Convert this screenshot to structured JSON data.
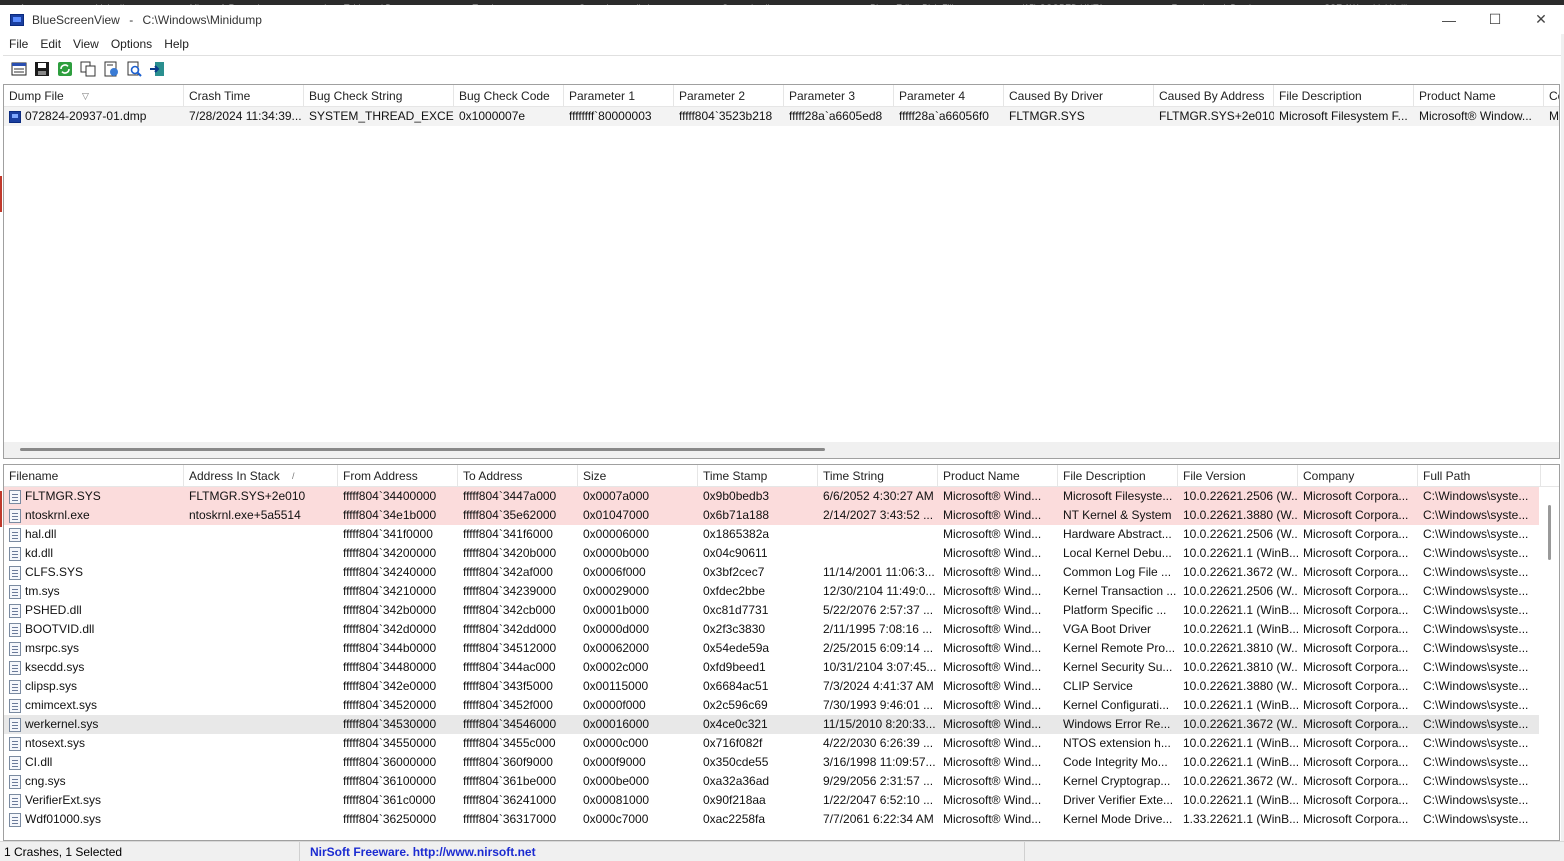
{
  "browser_tabs": [
    "...atsApp",
    "LinkedIn",
    "Microsoft Rewards",
    "Loot Table and Drop...",
    "Tacelt per...",
    "Grenades predictio...",
    "Sursa de alimentare...",
    "Photo Editor Pixlr Fili...",
    "(15) SCOPED UNTA...",
    "Forum thread: Destin...",
    "CSE AW: quidel Holli...",
    "Question - FC BGO..."
  ],
  "window": {
    "app_name": "BlueScreenView",
    "separator": "-",
    "path": "C:\\Windows\\Minidump",
    "minimize": "—",
    "maximize": "☐",
    "close": "✕"
  },
  "menu": [
    "File",
    "Edit",
    "View",
    "Options",
    "Help"
  ],
  "toolbar": [
    {
      "icon": "properties-icon",
      "tooltip": ""
    },
    {
      "icon": "save-icon",
      "tooltip": ""
    },
    {
      "icon": "refresh-icon",
      "tooltip": ""
    },
    {
      "icon": "copy-icon",
      "tooltip": ""
    },
    {
      "icon": "html-report-icon",
      "tooltip": ""
    },
    {
      "icon": "find-icon",
      "tooltip": ""
    },
    {
      "icon": "exit-icon",
      "tooltip": ""
    }
  ],
  "crashes": {
    "columns": [
      "Dump File",
      "Crash Time",
      "Bug Check String",
      "Bug Check Code",
      "Parameter 1",
      "Parameter 2",
      "Parameter 3",
      "Parameter 4",
      "Caused By Driver",
      "Caused By Address",
      "File Description",
      "Product Name",
      "Co"
    ],
    "sort_indicator": "▽",
    "rows": [
      [
        "072824-20937-01.dmp",
        "7/28/2024 11:34:39...",
        "SYSTEM_THREAD_EXCE...",
        "0x1000007e",
        "ffffffff`80000003",
        "fffff804`3523b218",
        "fffff28a`a6605ed8",
        "fffff28a`a66056f0",
        "FLTMGR.SYS",
        "FLTMGR.SYS+2e010",
        "Microsoft Filesystem F...",
        "Microsoft® Window...",
        "M"
      ]
    ]
  },
  "modules": {
    "columns": [
      "Filename",
      "Address In Stack",
      "From Address",
      "To Address",
      "Size",
      "Time Stamp",
      "Time String",
      "Product Name",
      "File Description",
      "File Version",
      "Company",
      "Full Path"
    ],
    "sort_indicator": "/",
    "rows": [
      {
        "style": "red",
        "cells": [
          "FLTMGR.SYS",
          "FLTMGR.SYS+2e010",
          "fffff804`34400000",
          "fffff804`3447a000",
          "0x0007a000",
          "0x9b0bedb3",
          "6/6/2052 4:30:27 AM",
          "Microsoft® Wind...",
          "Microsoft Filesyste...",
          "10.0.22621.2506 (W...",
          "Microsoft Corpora...",
          "C:\\Windows\\syste..."
        ]
      },
      {
        "style": "red",
        "cells": [
          "ntoskrnl.exe",
          "ntoskrnl.exe+5a5514",
          "fffff804`34e1b000",
          "fffff804`35e62000",
          "0x01047000",
          "0x6b71a188",
          "2/14/2027 3:43:52 ...",
          "Microsoft® Wind...",
          "NT Kernel & System",
          "10.0.22621.3880 (W...",
          "Microsoft Corpora...",
          "C:\\Windows\\syste..."
        ]
      },
      {
        "style": "",
        "cells": [
          "hal.dll",
          "",
          "fffff804`341f0000",
          "fffff804`341f6000",
          "0x00006000",
          "0x1865382a",
          "",
          "Microsoft® Wind...",
          "Hardware Abstract...",
          "10.0.22621.2506 (W...",
          "Microsoft Corpora...",
          "C:\\Windows\\syste..."
        ]
      },
      {
        "style": "",
        "cells": [
          "kd.dll",
          "",
          "fffff804`34200000",
          "fffff804`3420b000",
          "0x0000b000",
          "0x04c90611",
          "",
          "Microsoft® Wind...",
          "Local Kernel Debu...",
          "10.0.22621.1 (WinB...",
          "Microsoft Corpora...",
          "C:\\Windows\\syste..."
        ]
      },
      {
        "style": "",
        "cells": [
          "CLFS.SYS",
          "",
          "fffff804`34240000",
          "fffff804`342af000",
          "0x0006f000",
          "0x3bf2cec7",
          "11/14/2001 11:06:3...",
          "Microsoft® Wind...",
          "Common Log File ...",
          "10.0.22621.3672 (W...",
          "Microsoft Corpora...",
          "C:\\Windows\\syste..."
        ]
      },
      {
        "style": "",
        "cells": [
          "tm.sys",
          "",
          "fffff804`34210000",
          "fffff804`34239000",
          "0x00029000",
          "0xfdec2bbe",
          "12/30/2104 11:49:0...",
          "Microsoft® Wind...",
          "Kernel Transaction ...",
          "10.0.22621.2506 (W...",
          "Microsoft Corpora...",
          "C:\\Windows\\syste..."
        ]
      },
      {
        "style": "",
        "cells": [
          "PSHED.dll",
          "",
          "fffff804`342b0000",
          "fffff804`342cb000",
          "0x0001b000",
          "0xc81d7731",
          "5/22/2076 2:57:37 ...",
          "Microsoft® Wind...",
          "Platform Specific ...",
          "10.0.22621.1 (WinB...",
          "Microsoft Corpora...",
          "C:\\Windows\\syste..."
        ]
      },
      {
        "style": "",
        "cells": [
          "BOOTVID.dll",
          "",
          "fffff804`342d0000",
          "fffff804`342dd000",
          "0x0000d000",
          "0x2f3c3830",
          "2/11/1995 7:08:16 ...",
          "Microsoft® Wind...",
          "VGA Boot Driver",
          "10.0.22621.1 (WinB...",
          "Microsoft Corpora...",
          "C:\\Windows\\syste..."
        ]
      },
      {
        "style": "",
        "cells": [
          "msrpc.sys",
          "",
          "fffff804`344b0000",
          "fffff804`34512000",
          "0x00062000",
          "0x54ede59a",
          "2/25/2015 6:09:14 ...",
          "Microsoft® Wind...",
          "Kernel Remote Pro...",
          "10.0.22621.3810 (W...",
          "Microsoft Corpora...",
          "C:\\Windows\\syste..."
        ]
      },
      {
        "style": "",
        "cells": [
          "ksecdd.sys",
          "",
          "fffff804`34480000",
          "fffff804`344ac000",
          "0x0002c000",
          "0xfd9beed1",
          "10/31/2104 3:07:45...",
          "Microsoft® Wind...",
          "Kernel Security Su...",
          "10.0.22621.3810 (W...",
          "Microsoft Corpora...",
          "C:\\Windows\\syste..."
        ]
      },
      {
        "style": "",
        "cells": [
          "clipsp.sys",
          "",
          "fffff804`342e0000",
          "fffff804`343f5000",
          "0x00115000",
          "0x6684ac51",
          "7/3/2024 4:41:37 AM",
          "Microsoft® Wind...",
          "CLIP Service",
          "10.0.22621.3880 (W...",
          "Microsoft Corpora...",
          "C:\\Windows\\syste..."
        ]
      },
      {
        "style": "",
        "cells": [
          "cmimcext.sys",
          "",
          "fffff804`34520000",
          "fffff804`3452f000",
          "0x0000f000",
          "0x2c596c69",
          "7/30/1993 9:46:01 ...",
          "Microsoft® Wind...",
          "Kernel Configurati...",
          "10.0.22621.1 (WinB...",
          "Microsoft Corpora...",
          "C:\\Windows\\syste..."
        ]
      },
      {
        "style": "grey",
        "cells": [
          "werkernel.sys",
          "",
          "fffff804`34530000",
          "fffff804`34546000",
          "0x00016000",
          "0x4ce0c321",
          "11/15/2010 8:20:33...",
          "Microsoft® Wind...",
          "Windows Error Re...",
          "10.0.22621.3672 (W...",
          "Microsoft Corpora...",
          "C:\\Windows\\syste..."
        ]
      },
      {
        "style": "",
        "cells": [
          "ntosext.sys",
          "",
          "fffff804`34550000",
          "fffff804`3455c000",
          "0x0000c000",
          "0x716f082f",
          "4/22/2030 6:26:39 ...",
          "Microsoft® Wind...",
          "NTOS extension h...",
          "10.0.22621.1 (WinB...",
          "Microsoft Corpora...",
          "C:\\Windows\\syste..."
        ]
      },
      {
        "style": "",
        "cells": [
          "CI.dll",
          "",
          "fffff804`36000000",
          "fffff804`360f9000",
          "0x000f9000",
          "0x350cde55",
          "3/16/1998 11:09:57...",
          "Microsoft® Wind...",
          "Code Integrity Mo...",
          "10.0.22621.1 (WinB...",
          "Microsoft Corpora...",
          "C:\\Windows\\syste..."
        ]
      },
      {
        "style": "",
        "cells": [
          "cng.sys",
          "",
          "fffff804`36100000",
          "fffff804`361be000",
          "0x000be000",
          "0xa32a36ad",
          "9/29/2056 2:31:57 ...",
          "Microsoft® Wind...",
          "Kernel Cryptograp...",
          "10.0.22621.3672 (W...",
          "Microsoft Corpora...",
          "C:\\Windows\\syste..."
        ]
      },
      {
        "style": "",
        "cells": [
          "VerifierExt.sys",
          "",
          "fffff804`361c0000",
          "fffff804`36241000",
          "0x00081000",
          "0x90f218aa",
          "1/22/2047 6:52:10 ...",
          "Microsoft® Wind...",
          "Driver Verifier Exte...",
          "10.0.22621.1 (WinB...",
          "Microsoft Corpora...",
          "C:\\Windows\\syste..."
        ]
      },
      {
        "style": "",
        "cells": [
          "Wdf01000.sys",
          "",
          "fffff804`36250000",
          "fffff804`36317000",
          "0x000c7000",
          "0xac2258fa",
          "7/7/2061 6:22:34 AM",
          "Microsoft® Wind...",
          "Kernel Mode Drive...",
          "1.33.22621.1 (WinB...",
          "Microsoft Corpora...",
          "C:\\Windows\\syste..."
        ]
      }
    ]
  },
  "status": {
    "count": "1 Crashes, 1 Selected",
    "credit": "NirSoft Freeware.  http://www.nirsoft.net"
  }
}
